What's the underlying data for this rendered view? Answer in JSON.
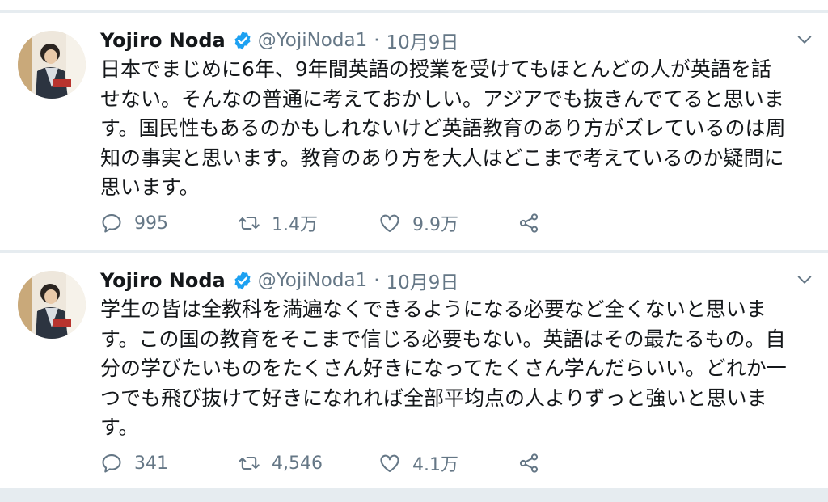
{
  "tweets": [
    {
      "display_name": "Yojiro Noda",
      "handle": "@YojiNoda1",
      "separator_dot": "·",
      "date": "10月9日",
      "text_lines": [
        "日本でまじめに6年、9年間英語の授業を受けてもほとんどの人が英語を話",
        "せない。そんなの普通に考えておかしい。アジアでも抜きんでてると思いま",
        "す。国民性もあるのかもしれないけど英語教育のあり方がズレているのは周",
        "知の事実と思います。教育のあり方を大人はどこまで考えているのか疑問に",
        "思います。"
      ],
      "reply_count": "995",
      "retweet_count": "1.4万",
      "like_count": "9.9万"
    },
    {
      "display_name": "Yojiro Noda",
      "handle": "@YojiNoda1",
      "separator_dot": "·",
      "date": "10月9日",
      "text_lines": [
        "学生の皆は全教科を満遍なくできるようになる必要など全くないと思いま",
        "す。この国の教育をそこまで信じる必要もない。英語はその最たるもの。自",
        "分の学びたいものをたくさん好きになってたくさん学んだらいい。どれか一",
        "つでも飛び抜けて好きになれれば全部平均点の人よりずっと強いと思いま",
        "す。"
      ],
      "reply_count": "341",
      "retweet_count": "4,546",
      "like_count": "4.1万"
    }
  ],
  "icons": {
    "verified": "verified-badge-icon",
    "caret": "chevron-down-icon",
    "reply": "reply-bubble-icon",
    "retweet": "retweet-icon",
    "like": "heart-icon",
    "share": "share-icon"
  },
  "colors": {
    "text_primary": "#14171a",
    "text_secondary": "#657786",
    "verified_blue": "#1da1f2",
    "background_gap": "#e6ecf0",
    "card": "#ffffff"
  }
}
